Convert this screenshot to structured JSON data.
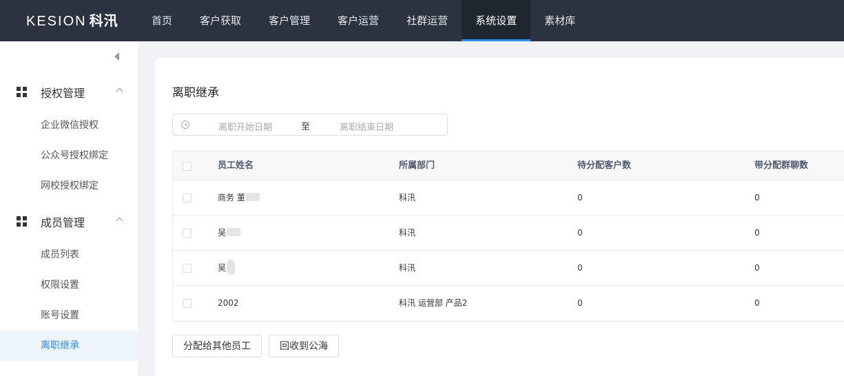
{
  "logo": {
    "brand": "KESION",
    "cn": "科汛"
  },
  "nav": [
    {
      "label": "首页"
    },
    {
      "label": "客户获取"
    },
    {
      "label": "客户管理"
    },
    {
      "label": "客户运营"
    },
    {
      "label": "社群运营"
    },
    {
      "label": "系统设置",
      "active": true
    },
    {
      "label": "素材库"
    }
  ],
  "sidebar": {
    "groups": [
      {
        "label": "授权管理",
        "items": [
          "企业微信授权",
          "公众号授权绑定",
          "网校授权绑定"
        ]
      },
      {
        "label": "成员管理",
        "items": [
          "成员列表",
          "权限设置",
          "账号设置",
          "离职继承"
        ]
      }
    ],
    "active_item": "离职继承"
  },
  "main": {
    "title": "离职继承",
    "date_range": {
      "start_placeholder": "离职开始日期",
      "separator": "至",
      "end_placeholder": "离职结束日期"
    },
    "table": {
      "headers": [
        "员工姓名",
        "所属部门",
        "待分配客户数",
        "带分配群聊数"
      ],
      "rows": [
        {
          "name": "商务 董",
          "dept": "科汛",
          "customers": "0",
          "groups": "0"
        },
        {
          "name": "吴",
          "dept": "科汛",
          "customers": "0",
          "groups": "0"
        },
        {
          "name": "吴",
          "dept": "科汛",
          "customers": "0",
          "groups": "0"
        },
        {
          "name": "2002",
          "dept": "科汛 运营部 产品2",
          "customers": "0",
          "groups": "0"
        }
      ]
    },
    "buttons": {
      "assign": "分配给其他员工",
      "recycle": "回收到公海"
    }
  }
}
